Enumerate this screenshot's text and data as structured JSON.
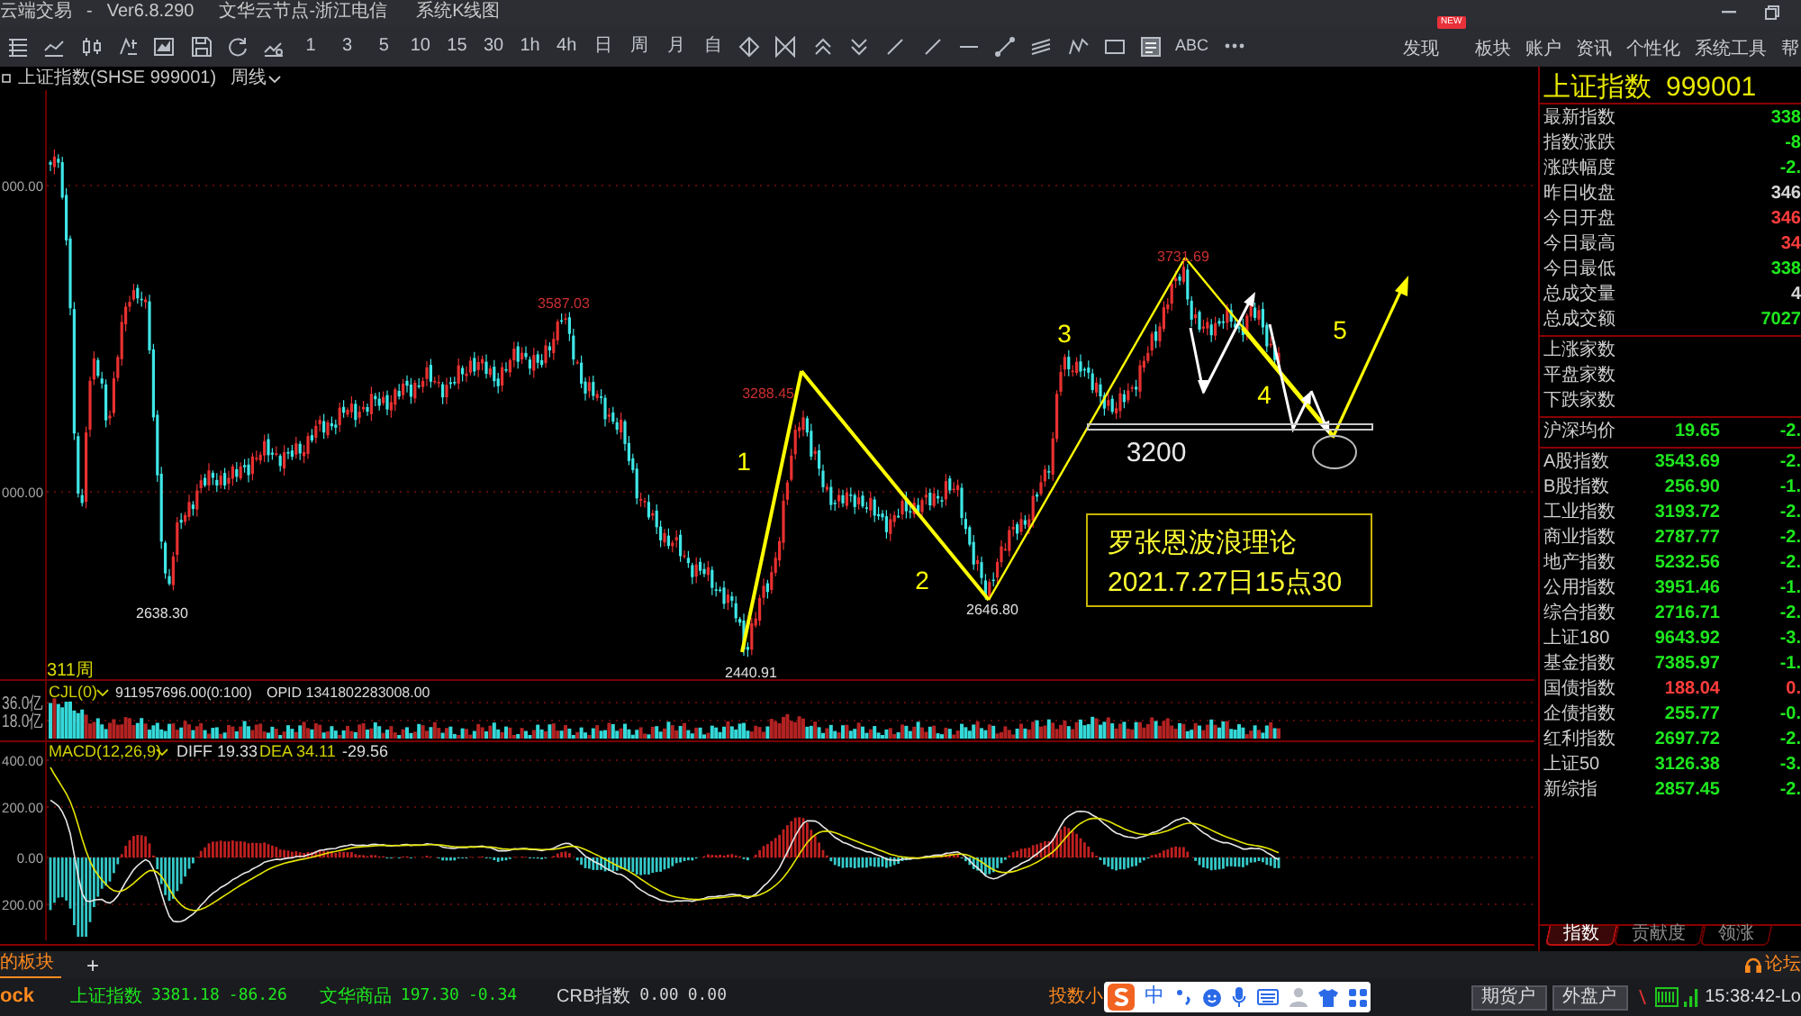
{
  "window": {
    "title": "云端交易",
    "separator": "-",
    "version": "Ver6.8.290",
    "node": "文华云节点-浙江电信",
    "view": "系统K线图"
  },
  "toolbar": {
    "periods": [
      "1",
      "3",
      "5",
      "10",
      "15",
      "30",
      "1h",
      "4h",
      "日",
      "周",
      "月",
      "自"
    ],
    "text_tool": "ABC"
  },
  "top_menu": [
    {
      "label": "发现",
      "badge": "NEW"
    },
    {
      "label": "板块"
    },
    {
      "label": "账户"
    },
    {
      "label": "资讯"
    },
    {
      "label": "个性化"
    },
    {
      "label": "系统工具"
    },
    {
      "label": "帮"
    }
  ],
  "chart_header": {
    "symbol": "上证指数(SHSE 999001)",
    "period": "周线"
  },
  "main_chart": {
    "axis_labels": [
      "000.00",
      "000.00"
    ],
    "extreme_labels": [
      {
        "text": "3587.03",
        "kind": "high"
      },
      {
        "text": "2638.30",
        "kind": "low"
      },
      {
        "text": "2440.91",
        "kind": "low"
      },
      {
        "text": "3288.45",
        "kind": "high"
      },
      {
        "text": "2646.80",
        "kind": "low"
      },
      {
        "text": "3731.69",
        "kind": "high"
      }
    ],
    "wave_labels": [
      "1",
      "2",
      "3",
      "4",
      "5"
    ],
    "support_label": "3200",
    "note": {
      "title": "罗张恩波浪理论",
      "time": "2021.7.27日15点30"
    },
    "bar_count": "311周"
  },
  "volume_panel": {
    "indicator": "CJL(0)",
    "reading": "911957696.00(0:100)",
    "opid": "OPID 1341802283008.00",
    "axis_labels": [
      "36.0亿",
      "18.0亿"
    ]
  },
  "macd_panel": {
    "indicator": "MACD(12,26,9)",
    "diff": "DIFF 19.33",
    "dea": "DEA 34.11",
    "macd": "-29.56",
    "axis_labels": [
      "400.00",
      "200.00",
      "0.00",
      "200.00"
    ]
  },
  "quote_panel": {
    "name": "上证指数",
    "code": "999001",
    "sections": [
      {
        "rows": [
          {
            "label": "最新指数",
            "value": "338",
            "color": "#1ee61e"
          },
          {
            "label": "指数涨跌",
            "value": "-8",
            "color": "#1ee61e"
          },
          {
            "label": "涨跌幅度",
            "value": "-2.",
            "color": "#1ee61e"
          },
          {
            "label": "昨日收盘",
            "value": "346",
            "color": "#d6d6d6"
          },
          {
            "label": "今日开盘",
            "value": "346",
            "color": "#ff3c3c"
          },
          {
            "label": "今日最高",
            "value": "34",
            "color": "#ff3c3c"
          },
          {
            "label": "今日最低",
            "value": "338",
            "color": "#1ee61e"
          },
          {
            "label": "总成交量",
            "value": "4",
            "color": "#d6d6d6"
          },
          {
            "label": "总成交额",
            "value": "7027",
            "color": "#1ee61e"
          }
        ]
      },
      {
        "rows": [
          {
            "label": "上涨家数"
          },
          {
            "label": "平盘家数"
          },
          {
            "label": "下跌家数"
          }
        ]
      },
      {
        "rows": [
          {
            "label": "沪深均价",
            "value": "19.65",
            "change": "-2.",
            "color": "#1ee61e"
          }
        ]
      },
      {
        "rows": [
          {
            "label": "A股指数",
            "value": "3543.69",
            "change": "-2.",
            "color": "#1ee61e"
          },
          {
            "label": "B股指数",
            "value": "256.90",
            "change": "-1.",
            "color": "#1ee61e"
          },
          {
            "label": "工业指数",
            "value": "3193.72",
            "change": "-2.",
            "color": "#1ee61e"
          },
          {
            "label": "商业指数",
            "value": "2787.77",
            "change": "-2.",
            "color": "#1ee61e"
          },
          {
            "label": "地产指数",
            "value": "5232.56",
            "change": "-2.",
            "color": "#1ee61e"
          },
          {
            "label": "公用指数",
            "value": "3951.46",
            "change": "-1.",
            "color": "#1ee61e"
          },
          {
            "label": "综合指数",
            "value": "2716.71",
            "change": "-2.",
            "color": "#1ee61e"
          },
          {
            "label": "上证180",
            "value": "9643.92",
            "change": "-3.",
            "color": "#1ee61e"
          },
          {
            "label": "基金指数",
            "value": "7385.97",
            "change": "-1.",
            "color": "#1ee61e"
          },
          {
            "label": "国债指数",
            "value": "188.04",
            "change": "0.",
            "color": "#ff3c3c"
          },
          {
            "label": "企债指数",
            "value": "255.77",
            "change": "-0.",
            "color": "#1ee61e"
          },
          {
            "label": "红利指数",
            "value": "2697.72",
            "change": "-2.",
            "color": "#1ee61e"
          },
          {
            "label": "上证50",
            "value": "3126.38",
            "change": "-3.",
            "color": "#1ee61e"
          },
          {
            "label": "新综指",
            "value": "2857.45",
            "change": "-2.",
            "color": "#1ee61e"
          }
        ]
      }
    ],
    "tabs": [
      {
        "label": "指数",
        "selected": true
      },
      {
        "label": "贡献度",
        "selected": false
      },
      {
        "label": "领涨",
        "selected": false
      }
    ]
  },
  "bottom_tabs": {
    "tabs": [
      {
        "label": "的板块",
        "selected": true
      }
    ],
    "add": "+",
    "forum": "论坛"
  },
  "status_bar": {
    "logo": "ock",
    "tickers": [
      {
        "name": "上证指数",
        "price": "3381.18",
        "change": "-86.26",
        "color": "#1ee61e"
      },
      {
        "name": "文华商品",
        "price": "197.30",
        "change": "-0.34",
        "color": "#1ee61e"
      },
      {
        "name": "CRB指数",
        "price": "0.00",
        "change": "0.00",
        "color": "#d6d6d6"
      }
    ],
    "partial_text": "投数小",
    "ime_mode": "中",
    "buttons": [
      "期货户",
      "外盘户"
    ],
    "time": "15:38:42-Lo"
  }
}
